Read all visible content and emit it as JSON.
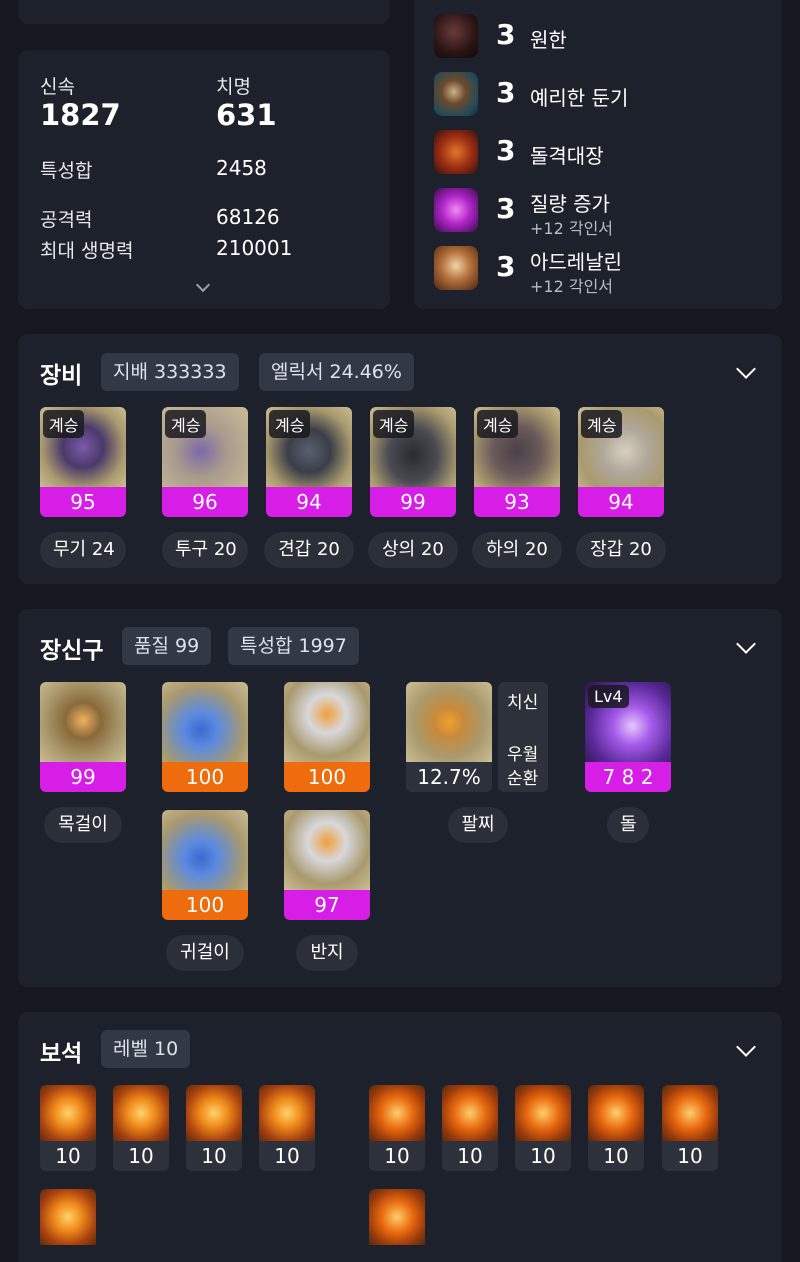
{
  "stats": {
    "speed_label": "신속",
    "speed_value": "1827",
    "crit_label": "치명",
    "crit_value": "631",
    "trait_sum_label": "특성합",
    "trait_sum_value": "2458",
    "attack_label": "공격력",
    "attack_value": "68126",
    "maxhp_label": "최대 생명력",
    "maxhp_value": "210001"
  },
  "engravings": [
    {
      "level": "3",
      "name": "원한",
      "sub": "",
      "icon": "wolf-demon-icon"
    },
    {
      "level": "3",
      "name": "예리한 둔기",
      "sub": "",
      "icon": "spiked-mace-icon"
    },
    {
      "level": "3",
      "name": "돌격대장",
      "sub": "",
      "icon": "charge-captain-icon"
    },
    {
      "level": "3",
      "name": "질량 증가",
      "sub": "+12 각인서",
      "icon": "mass-increase-icon"
    },
    {
      "level": "3",
      "name": "아드레날린",
      "sub": "+12 각인서",
      "icon": "adrenaline-icon"
    }
  ],
  "equipment": {
    "title": "장비",
    "chip1": "지배 333333",
    "chip2": "엘릭서 24.46%",
    "items": [
      {
        "tag": "계승",
        "quality": "95",
        "label": "무기 24",
        "icon": "weapon-icon"
      },
      {
        "tag": "계승",
        "quality": "96",
        "label": "투구 20",
        "icon": "helmet-icon"
      },
      {
        "tag": "계승",
        "quality": "94",
        "label": "견갑 20",
        "icon": "shoulder-icon"
      },
      {
        "tag": "계승",
        "quality": "99",
        "label": "상의 20",
        "icon": "chest-armor-icon"
      },
      {
        "tag": "계승",
        "quality": "93",
        "label": "하의 20",
        "icon": "leg-armor-icon"
      },
      {
        "tag": "계승",
        "quality": "94",
        "label": "장갑 20",
        "icon": "glove-icon"
      }
    ]
  },
  "accessories": {
    "title": "장신구",
    "chip1": "품질 99",
    "chip2": "특성합 1997",
    "necklace": {
      "quality": "99",
      "label": "목걸이"
    },
    "earring1": {
      "quality": "100"
    },
    "ring1": {
      "quality": "100"
    },
    "earring2": {
      "quality": "100"
    },
    "ring2": {
      "quality": "97"
    },
    "earring_label": "귀걸이",
    "ring_label": "반지",
    "bracelet": {
      "value": "12.7%",
      "opt1": "치신",
      "opt2": "우월",
      "opt3": "순환",
      "label": "팔찌"
    },
    "stone": {
      "tag": "Lv4",
      "value": "7 8 2",
      "label": "돌"
    }
  },
  "gems": {
    "title": "보석",
    "chip": "레벨 10",
    "levels": [
      "10",
      "10",
      "10",
      "10",
      "10",
      "10",
      "10",
      "10",
      "10"
    ]
  },
  "colors": {
    "quality_magenta": "#d71ee6",
    "quality_orange": "#ee6b0e",
    "card_bg": "#1d212b",
    "page_bg": "#15181f"
  }
}
